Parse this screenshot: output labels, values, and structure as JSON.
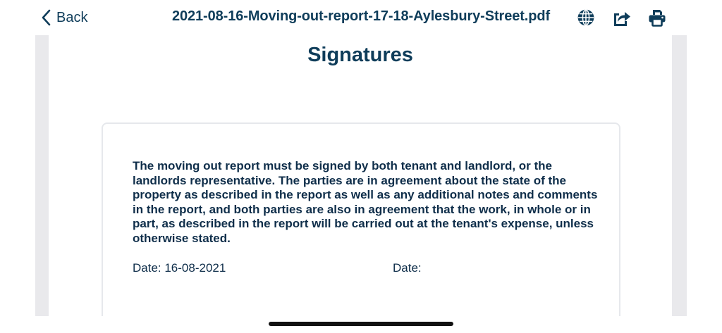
{
  "nav": {
    "back_label": "Back",
    "document_title": "2021-08-16-Moving-out-report-17-18-Aylesbury-Street.pdf"
  },
  "toolbar": {
    "icons": [
      "globe-icon",
      "share-icon",
      "print-icon"
    ]
  },
  "page": {
    "heading": "Signatures",
    "agreement_text": "The moving out report must be signed by both tenant and landlord, or the landlords representative. The parties are in agreement about the state of the property as described in the report as well as any additional notes and comments in the report, and both parties are also in agreement that the work, in whole or in part, as described in the report will be carried out at the tenant's expense, unless otherwise stated.",
    "tenant_date": "Date: 16-08-2021",
    "landlord_date": "Date:"
  },
  "colors": {
    "accent": "#0f3d5a",
    "text": "#0f2e4a",
    "viewer_background": "#e9e9ec"
  }
}
